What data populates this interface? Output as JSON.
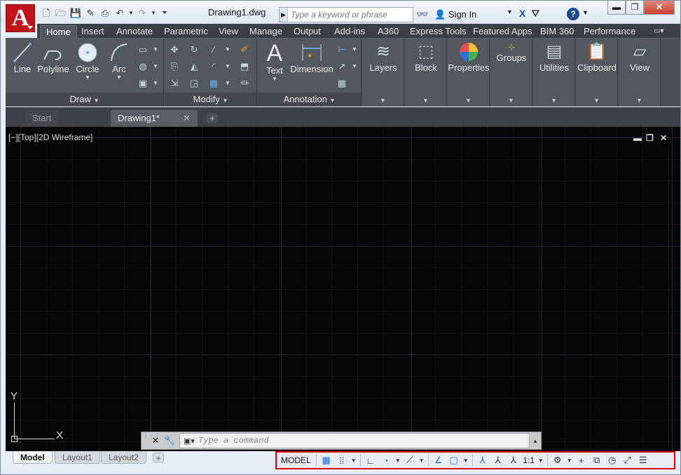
{
  "app": {
    "document_title": "Drawing1.dwg",
    "logo_letter": "A",
    "brand_color": "#c0141a"
  },
  "quick_access": [
    "new-icon",
    "open-icon",
    "save-icon",
    "save-as-icon",
    "plot-icon",
    "undo-icon",
    "redo-icon",
    "customize-icon"
  ],
  "search": {
    "placeholder": "Type a keyword or phrase"
  },
  "account": {
    "sign_in": "Sign In"
  },
  "ribbon_tabs": [
    "Home",
    "Insert",
    "Annotate",
    "Parametric",
    "View",
    "Manage",
    "Output",
    "Add-ins",
    "A360",
    "Express Tools",
    "Featured Apps",
    "BIM 360",
    "Performance"
  ],
  "ribbon": {
    "draw": {
      "title": "Draw",
      "line": "Line",
      "polyline": "Polyline",
      "circle": "Circle",
      "arc": "Arc"
    },
    "modify": {
      "title": "Modify"
    },
    "annotation": {
      "title": "Annotation",
      "text": "Text",
      "dimension": "Dimension"
    },
    "layers": "Layers",
    "block": "Block",
    "properties": "Properties",
    "groups": "Groups",
    "utilities": "Utilities",
    "clipboard": "Clipboard",
    "view": "View"
  },
  "doc_tabs": {
    "start": "Start",
    "active": "Drawing1*"
  },
  "viewport": {
    "label": "[−][Top][2D Wireframe]"
  },
  "ucs": {
    "x": "X",
    "y": "Y"
  },
  "command": {
    "placeholder": "Type a command"
  },
  "layout_tabs": [
    "Model",
    "Layout1",
    "Layout2"
  ],
  "status": {
    "model": "MODEL",
    "scale": "1:1"
  },
  "colors": {
    "canvas": "#050608",
    "ribbon": "#4a4e55",
    "status_highlight": "#e00000"
  }
}
